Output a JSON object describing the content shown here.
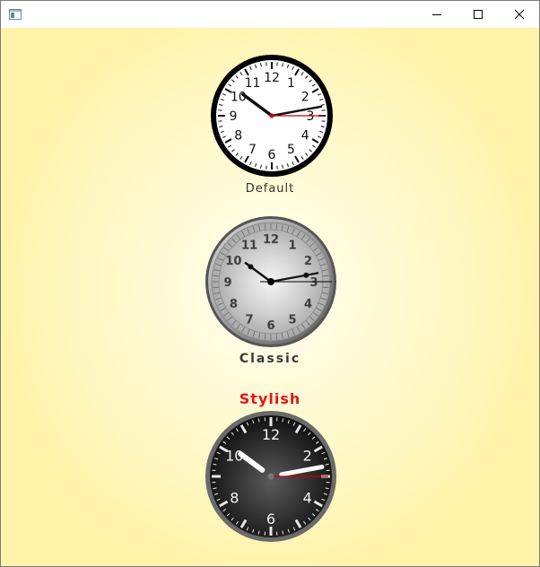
{
  "window": {
    "controls": {
      "minimize_icon": "minimize-icon",
      "maximize_icon": "maximize-icon",
      "close_icon": "close-icon"
    }
  },
  "clocks": [
    {
      "label": "Default",
      "style": "default",
      "numerals": [
        "12",
        "1",
        "2",
        "3",
        "4",
        "5",
        "6",
        "7",
        "8",
        "9",
        "10",
        "11"
      ],
      "time": {
        "hour": 10,
        "minute": 13,
        "second": 15
      },
      "label_color": "#333333"
    },
    {
      "label": "Classic",
      "style": "classic",
      "numerals": [
        "12",
        "1",
        "2",
        "3",
        "4",
        "5",
        "6",
        "7",
        "8",
        "9",
        "10",
        "11"
      ],
      "time": {
        "hour": 10,
        "minute": 13,
        "second": 15
      },
      "label_color": "#3a3a3a"
    },
    {
      "label": "Stylish",
      "style": "stylish",
      "numerals": [
        "12",
        "2",
        "4",
        "6",
        "8",
        "10"
      ],
      "numeral_hours": [
        12,
        2,
        4,
        6,
        8,
        10
      ],
      "time": {
        "hour": 10,
        "minute": 13,
        "second": 15
      },
      "label_color": "#e8141b"
    }
  ],
  "colors": {
    "background": "#fff7bf",
    "second_hand": "#cc0000",
    "stylish_label": "#e8141b"
  }
}
